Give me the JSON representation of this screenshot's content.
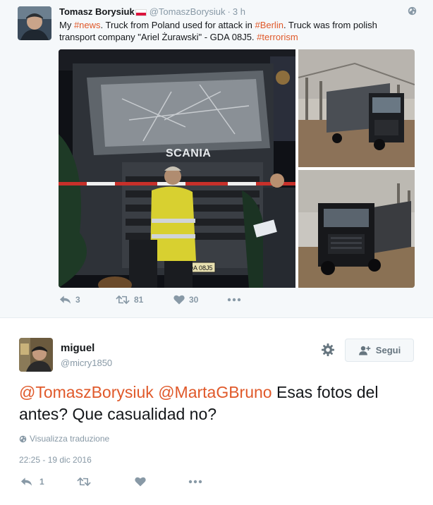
{
  "quoted_tweet": {
    "display_name": "Tomasz Borysiuk",
    "handle": "@TomaszBorysiuk",
    "time": "3 h",
    "text_segments": [
      {
        "text": "My ",
        "highlight": false
      },
      {
        "text": "#news",
        "highlight": true
      },
      {
        "text": ". Truck from Poland used for attack in ",
        "highlight": false
      },
      {
        "text": "#Berlin",
        "highlight": true
      },
      {
        "text": ". Truck was from polish transport company \"Ariel Żurawski\" - GDA 08J5. ",
        "highlight": false
      },
      {
        "text": "#terrorism",
        "highlight": true
      }
    ],
    "photo_plates": {
      "truck_badge": "SCANIA",
      "license_plate": "GDA 08J5"
    },
    "actions": {
      "reply_count": "3",
      "retweet_count": "81",
      "like_count": "30"
    }
  },
  "main_tweet": {
    "display_name": "miguel",
    "handle": "@micry1850",
    "follow_label": "Segui",
    "text_segments": [
      {
        "text": "@TomaszBorysiuk",
        "highlight": true
      },
      {
        "text": " ",
        "highlight": false
      },
      {
        "text": "@MartaGBruno",
        "highlight": true
      },
      {
        "text": " Esas fotos del antes? Que casualidad no?",
        "highlight": false
      }
    ],
    "translate_label": "Visualizza traduzione",
    "timestamp": "22:25 - 19 dic 2016",
    "actions": {
      "reply_count": "1"
    }
  },
  "icons": {
    "reply": "reply-icon",
    "retweet": "retweet-icon",
    "like": "heart-icon",
    "more": "more-icon",
    "globe": "globe-icon",
    "settings": "gear-icon",
    "follow": "follow-user-icon"
  },
  "colors": {
    "hashtag": "#e0592a",
    "muted": "#8899a6",
    "text": "#14171a",
    "quote_bg": "#f5f8fa"
  }
}
